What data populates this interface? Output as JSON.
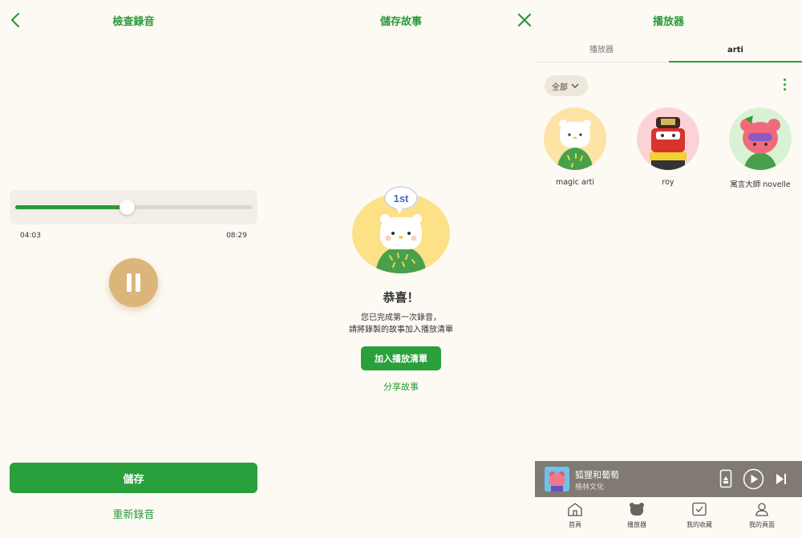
{
  "review": {
    "title": "檢查錄音",
    "progress_fraction": 0.47,
    "current_time": "04:03",
    "total_time": "08:29",
    "save_label": "儲存",
    "rerecord_label": "重新錄音"
  },
  "save_story": {
    "title": "儲存故事",
    "badge": "1st",
    "congrats": "恭喜！",
    "message_line1": "您已完成第一次錄音，",
    "message_line2": "請將錄製的故事加入播放清單",
    "add_button": "加入播放清單",
    "share_label": "分享故事"
  },
  "player": {
    "title": "播放器",
    "tabs": [
      "播放器",
      "arti"
    ],
    "active_tab": "arti",
    "filter_label": "全部",
    "characters": [
      {
        "name": "magic arti",
        "color": "#fde3a6"
      },
      {
        "name": "roy",
        "color": "#fbd3d6"
      },
      {
        "name": "寓言大師 novelle",
        "color": "#d9f2d4"
      }
    ],
    "now_playing": {
      "title": "狐狸和葡萄",
      "subtitle": "格林文化"
    },
    "nav": [
      "首頁",
      "播放器",
      "我的收藏",
      "我的頁面"
    ]
  },
  "colors": {
    "accent_green": "#2aa03c",
    "pause_gold": "#dcb57a",
    "background": "#fdfaf4",
    "mini_player": "#807a73"
  }
}
